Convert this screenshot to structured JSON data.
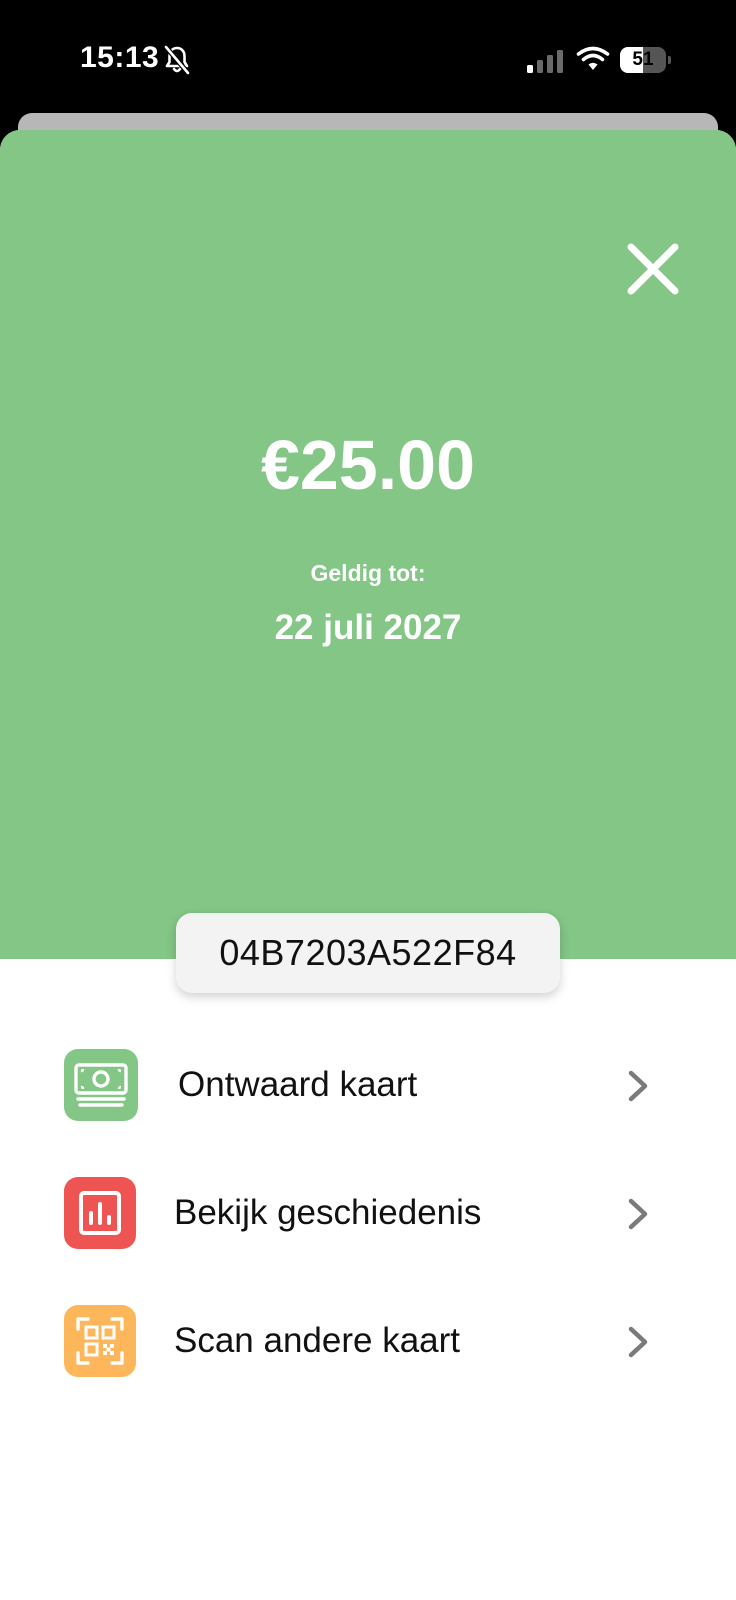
{
  "status_bar": {
    "time": "15:13",
    "battery_level": "51",
    "battery_fraction": 0.51,
    "icons": [
      "bell-muted-icon",
      "signal-icon",
      "wifi-icon",
      "battery-icon"
    ]
  },
  "card": {
    "amount": "€25.00",
    "valid_label": "Geldig tot:",
    "valid_date": "22 juli 2027",
    "code": "04B7203A522F84",
    "background_color": "#83c686"
  },
  "actions": [
    {
      "label": "Ontwaard kaart",
      "icon": "money-icon",
      "color": "#83c686"
    },
    {
      "label": "Bekijk geschiedenis",
      "icon": "chart-icon",
      "color": "#ee5552"
    },
    {
      "label": "Scan andere kaart",
      "icon": "qr-code-icon",
      "color": "#fdb65a"
    }
  ]
}
